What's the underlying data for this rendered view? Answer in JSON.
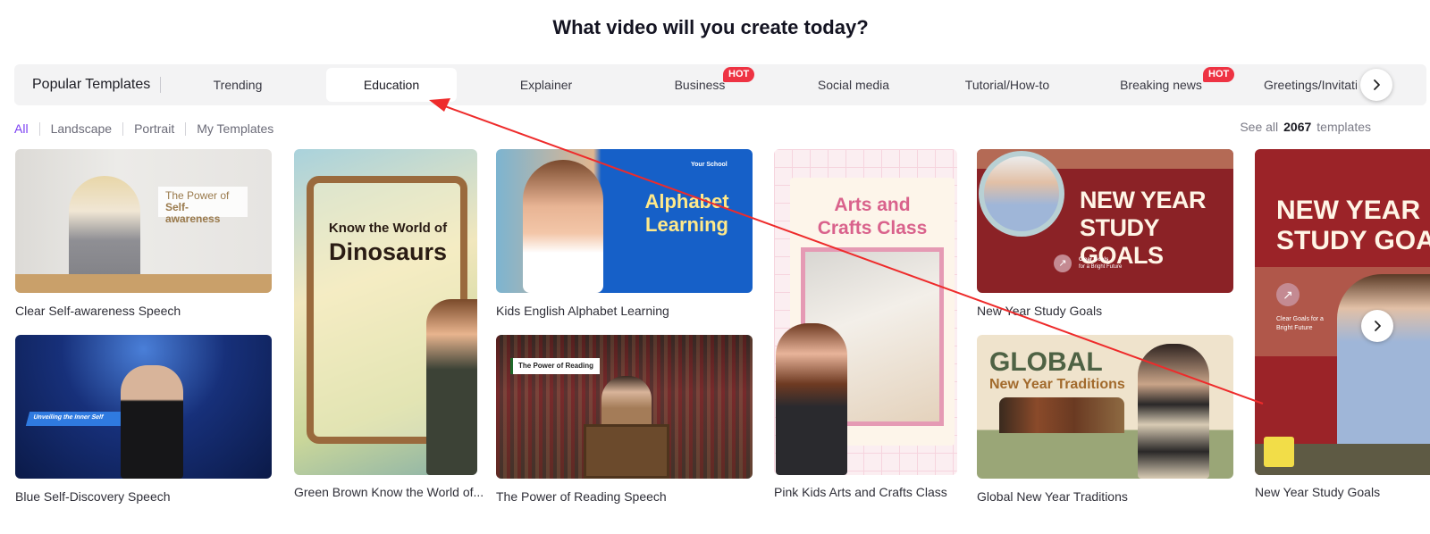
{
  "header": {
    "title": "What video will you create today?"
  },
  "category_bar": {
    "lead_label": "Popular Templates",
    "tabs": [
      {
        "label": "Trending",
        "active": false,
        "hot": false
      },
      {
        "label": "Education",
        "active": true,
        "hot": false
      },
      {
        "label": "Explainer",
        "active": false,
        "hot": false
      },
      {
        "label": "Business",
        "active": false,
        "hot": true
      },
      {
        "label": "Social media",
        "active": false,
        "hot": false
      },
      {
        "label": "Tutorial/How-to",
        "active": false,
        "hot": false
      },
      {
        "label": "Breaking news",
        "active": false,
        "hot": true
      },
      {
        "label": "Greetings/Invitatio",
        "active": false,
        "hot": false
      }
    ],
    "hot_badge": "HOT",
    "next_icon": "chevron-right-icon"
  },
  "filters": {
    "items": [
      {
        "label": "All",
        "active": true
      },
      {
        "label": "Landscape",
        "active": false
      },
      {
        "label": "Portrait",
        "active": false
      },
      {
        "label": "My Templates",
        "active": false
      }
    ],
    "accent_color": "#7b3ff2"
  },
  "see_all": {
    "prefix": "See all",
    "count": "2067",
    "suffix": "templates"
  },
  "templates": [
    {
      "title": "Clear Self-awareness Speech",
      "thumb_text": [
        "The Power of",
        "Self-awareness"
      ]
    },
    {
      "title": "Blue Self-Discovery Speech",
      "thumb_text": [
        "Unveiling the Inner Self"
      ]
    },
    {
      "title": "Green Brown Know the World of...",
      "thumb_text": [
        "Know the World of",
        "Dinosaurs"
      ]
    },
    {
      "title": "Kids English Alphabet Learning",
      "thumb_text": [
        "Your School",
        "Alphabet",
        "Learning"
      ]
    },
    {
      "title": "The Power of Reading Speech",
      "thumb_text": [
        "The Power of Reading"
      ]
    },
    {
      "title": "Pink Kids Arts and Crafts Class",
      "thumb_text": [
        "Arts and",
        "Crafts Class"
      ]
    },
    {
      "title": "New Year Study Goals",
      "thumb_text": [
        "NEW YEAR",
        "STUDY GOALS",
        "Clear Goals",
        "for a Bright Future"
      ]
    },
    {
      "title": "Global New Year Traditions",
      "thumb_text": [
        "GLOBAL",
        "New Year Traditions"
      ]
    },
    {
      "title": "New Year Study Goals",
      "thumb_text": [
        "NEW YEAR",
        "STUDY GOALS",
        "Clear Goals for a",
        "Bright Future"
      ]
    }
  ],
  "annotation": {
    "type": "arrow",
    "color": "#ee2b2b",
    "points_to": "Education tab"
  }
}
